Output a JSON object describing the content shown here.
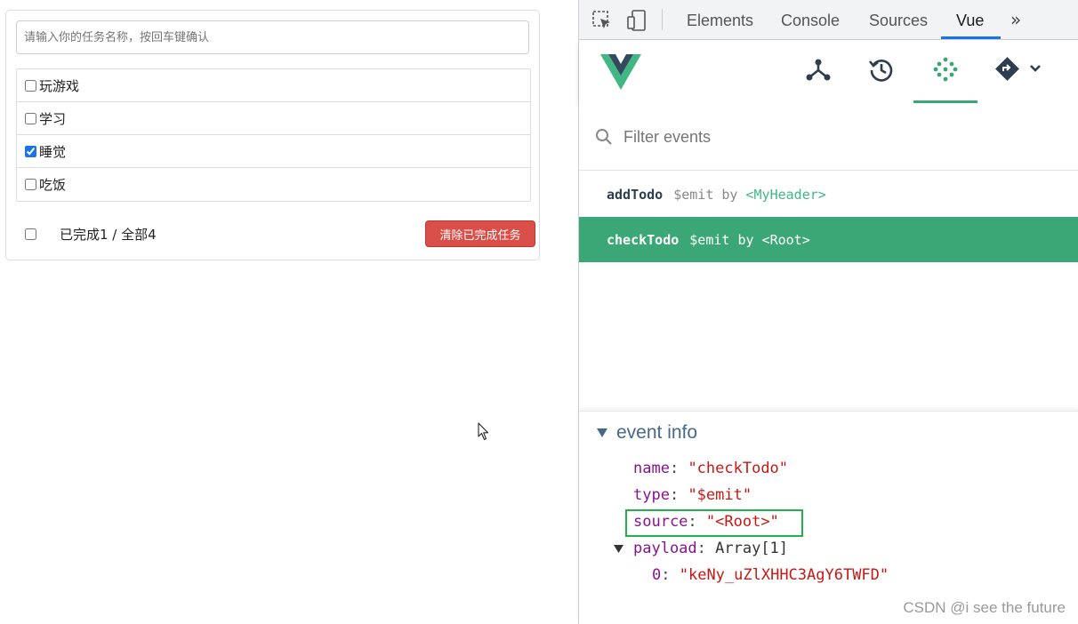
{
  "todo": {
    "input_placeholder": "请输入你的任务名称，按回车键确认",
    "items": [
      {
        "label": "玩游戏",
        "checked": false
      },
      {
        "label": "学习",
        "checked": false
      },
      {
        "label": "睡觉",
        "checked": true
      },
      {
        "label": "吃饭",
        "checked": false
      }
    ],
    "footer_text": "已完成1 / 全部4",
    "clear_button": "清除已完成任务"
  },
  "devtools": {
    "tabs": [
      "Elements",
      "Console",
      "Sources",
      "Vue"
    ],
    "active_tab": "Vue",
    "more_label": "»",
    "vue_tools": [
      "components-icon",
      "history-icon",
      "events-icon",
      "router-icon"
    ],
    "active_tool": "events-icon",
    "filter_placeholder": "Filter events",
    "events": [
      {
        "name": "addTodo",
        "meta": "$emit by",
        "component": "<MyHeader>",
        "selected": false
      },
      {
        "name": "checkTodo",
        "meta": "$emit by",
        "component": "<Root>",
        "selected": true
      }
    ],
    "event_info": {
      "title": "event info",
      "name_key": "name",
      "name_val": "\"checkTodo\"",
      "type_key": "type",
      "type_val": "\"$emit\"",
      "source_key": "source",
      "source_val": "\"<Root>\"",
      "payload_key": "payload",
      "payload_val": "Array[1]",
      "item_key": "0",
      "item_val": "\"keNy_uZlXHHC3AgY6TWFD\""
    },
    "accent_color": "#3ba776"
  },
  "watermark": "CSDN @i see the future"
}
